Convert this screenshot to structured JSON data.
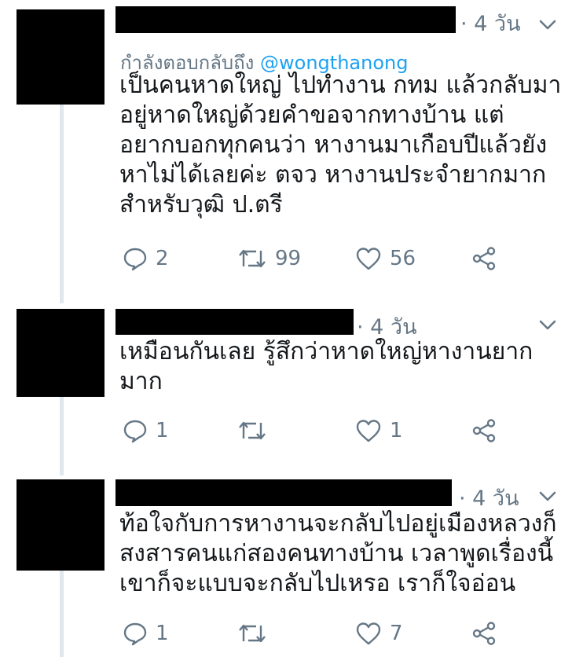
{
  "colors": {
    "text": "#14171a",
    "secondary": "#657786",
    "link": "#1da1f2",
    "thread_line": "#e1e8ed",
    "redaction": "#000000"
  },
  "tweets": [
    {
      "time": "· 4 วัน",
      "reply_prefix": "กำลังตอบกลับถึง",
      "reply_handle": "@wongthanong",
      "lines": [
        "เป็นคนหาดใหญ่ ไปทำงาน กทม แล้วกลับมา",
        "อยู่หาดใหญ่ด้วยคำขอจากทางบ้าน แต่",
        "อยากบอกทุกคนว่า หางานมาเกือบปีแล้วยัง",
        "หาไม่ได้เลยค่ะ ตจว หางานประจำยากมาก",
        "สำหรับวุฒิ ป.ตรี"
      ],
      "replies": "2",
      "retweets": "99",
      "likes": "56"
    },
    {
      "time": "· 4 วัน",
      "lines": [
        "เหมือนกันเลย รู้สึกว่าหาดใหญ่หางานยาก",
        "มาก"
      ],
      "replies": "1",
      "retweets": "",
      "likes": "1"
    },
    {
      "time": "· 4 วัน",
      "lines": [
        "ท้อใจกับการหางานจะกลับไปอยู่เมืองหลวงก็",
        "สงสารคนแก่สองคนทางบ้าน เวลาพูดเรื่องนี้",
        "เขาก็จะแบบจะกลับไปเหรอ เราก็ใจอ่อน"
      ],
      "replies": "1",
      "retweets": "",
      "likes": "7"
    }
  ]
}
